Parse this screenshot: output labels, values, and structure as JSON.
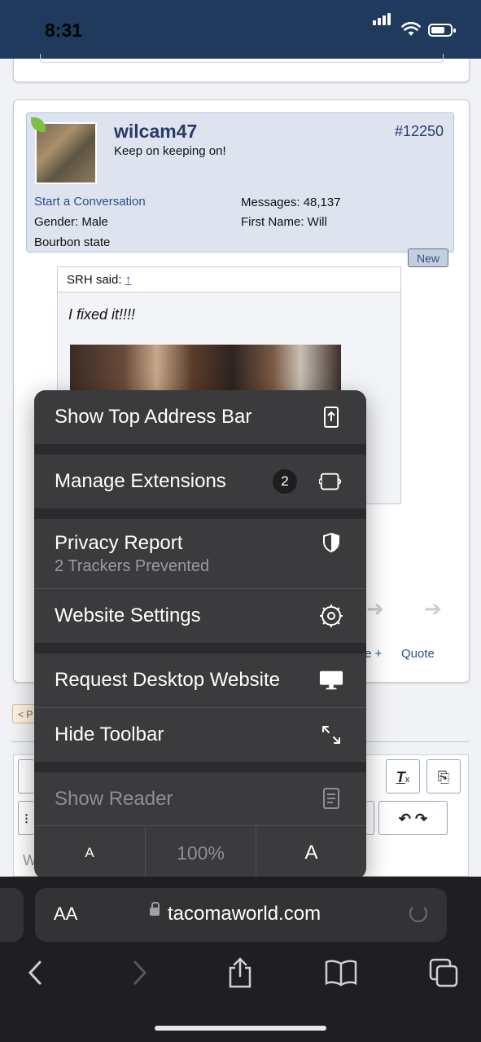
{
  "status_bar": {
    "time": "8:31"
  },
  "post": {
    "username": "wilcam47",
    "user_title": "Keep on keeping on!",
    "post_number": "#12250",
    "start_conversation": "Start a Conversation",
    "gender": "Gender: Male",
    "location": "Bourbon state",
    "messages": "Messages: 48,137",
    "first_name": "First Name: Will",
    "new_badge": "New",
    "quote_author": "SRH said:",
    "quote_arrow": "↑",
    "quote_text": "I fixed it!!!!",
    "actions": {
      "partial_label": "te +",
      "quote": "Quote"
    }
  },
  "pagination": {
    "prev_label": "< P"
  },
  "editor": {
    "placeholder_partial": "W"
  },
  "safari_menu": {
    "items": [
      {
        "label": "Show Top Address Bar",
        "icon": "top-address-bar-icon"
      },
      {
        "label": "Manage Extensions",
        "badge": "2",
        "icon": "extensions-icon"
      },
      {
        "label": "Privacy Report",
        "sublabel": "2 Trackers Prevented",
        "icon": "shield-icon"
      },
      {
        "label": "Website Settings",
        "icon": "gear-icon"
      },
      {
        "label": "Request Desktop Website",
        "icon": "desktop-icon"
      },
      {
        "label": "Hide Toolbar",
        "icon": "resize-arrows-icon"
      },
      {
        "label": "Show Reader",
        "icon": "reader-icon",
        "disabled": true
      }
    ],
    "zoom": {
      "smaller": "A",
      "level": "100%",
      "larger": "A"
    }
  },
  "address_bar": {
    "aa_label": "AA",
    "url": "tacomaworld.com"
  }
}
